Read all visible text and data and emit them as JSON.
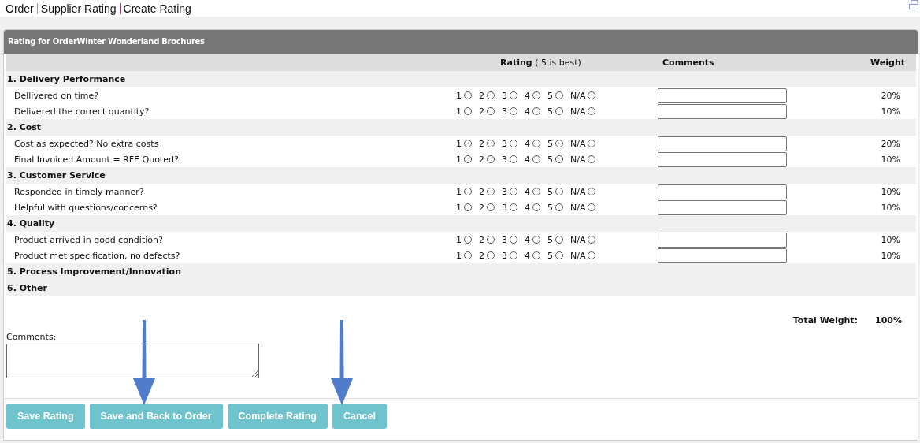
{
  "breadcrumb": [
    "Order",
    "Supplier Rating",
    "Create Rating"
  ],
  "panel_title": "Rating for OrderWinter Wonderland Brochures",
  "columns": {
    "rating": "Rating",
    "rating_hint": "( 5 is best)",
    "comments": "Comments",
    "weight": "Weight"
  },
  "categories": [
    {
      "title": "1. Delivery Performance",
      "items": [
        {
          "question": "Dellivered on time?",
          "weight": "20%",
          "options": [
            {
              "label": "1",
              "selected": false
            },
            {
              "label": "2",
              "selected": false
            },
            {
              "label": "3",
              "selected": false
            },
            {
              "label": "4",
              "selected": false
            },
            {
              "label": "5",
              "selected": false
            },
            {
              "label": "N/A",
              "selected": false
            }
          ]
        },
        {
          "question": "Delivered the correct quantity?",
          "weight": "10%",
          "options": [
            {
              "label": "1",
              "selected": false
            },
            {
              "label": "2",
              "selected": false
            },
            {
              "label": "3",
              "selected": false
            },
            {
              "label": "4",
              "selected": false
            },
            {
              "label": "5",
              "selected": false
            },
            {
              "label": "N/A",
              "selected": false
            }
          ]
        }
      ]
    },
    {
      "title": "2. Cost",
      "items": [
        {
          "question": "Cost as expected? No extra costs",
          "weight": "20%",
          "options": [
            {
              "label": "1",
              "selected": false
            },
            {
              "label": "2",
              "selected": false
            },
            {
              "label": "3",
              "selected": false
            },
            {
              "label": "4",
              "selected": false
            },
            {
              "label": "5",
              "selected": false
            },
            {
              "label": "N/A",
              "selected": false
            }
          ]
        },
        {
          "question": "Final Invoiced Amount = RFE Quoted?",
          "weight": "10%",
          "options": [
            {
              "label": "1",
              "selected": false
            },
            {
              "label": "2",
              "selected": false
            },
            {
              "label": "3",
              "selected": false
            },
            {
              "label": "4",
              "selected": false
            },
            {
              "label": "5",
              "selected": false
            },
            {
              "label": "N/A",
              "selected": false
            }
          ]
        }
      ]
    },
    {
      "title": "3. Customer Service",
      "items": [
        {
          "question": "Responded in timely manner?",
          "weight": "10%",
          "options": [
            {
              "label": "1",
              "selected": false
            },
            {
              "label": "2",
              "selected": false
            },
            {
              "label": "3",
              "selected": false
            },
            {
              "label": "4",
              "selected": false
            },
            {
              "label": "5",
              "selected": false
            },
            {
              "label": "N/A",
              "selected": false
            }
          ]
        },
        {
          "question": "Helpful with questions/concerns?",
          "weight": "10%",
          "options": [
            {
              "label": "1",
              "selected": false
            },
            {
              "label": "2",
              "selected": false
            },
            {
              "label": "3",
              "selected": false
            },
            {
              "label": "4",
              "selected": false
            },
            {
              "label": "5",
              "selected": false
            },
            {
              "label": "N/A",
              "selected": false
            }
          ]
        }
      ]
    },
    {
      "title": "4. Quality",
      "items": [
        {
          "question": "Product arrived in good condition?",
          "weight": "10%",
          "options": [
            {
              "label": "1",
              "selected": false
            },
            {
              "label": "2",
              "selected": false
            },
            {
              "label": "3",
              "selected": false
            },
            {
              "label": "4",
              "selected": false
            },
            {
              "label": "5",
              "selected": false
            },
            {
              "label": "N/A",
              "selected": false
            }
          ]
        },
        {
          "question": "Product met specification, no defects?",
          "weight": "10%",
          "options": [
            {
              "label": "1",
              "selected": false
            },
            {
              "label": "2",
              "selected": false
            },
            {
              "label": "3",
              "selected": false
            },
            {
              "label": "4",
              "selected": false
            },
            {
              "label": "5",
              "selected": false
            },
            {
              "label": "N/A",
              "selected": false
            }
          ]
        }
      ]
    },
    {
      "title": "5. Process Improvement/Innovation"
    },
    {
      "title": "6. Other"
    }
  ],
  "total": {
    "label": "Total Weight:",
    "value": "100%"
  },
  "comments_label": "Comments:",
  "buttons": [
    "Save Rating",
    "Save and Back to Order",
    "Complete Rating",
    "Cancel"
  ]
}
